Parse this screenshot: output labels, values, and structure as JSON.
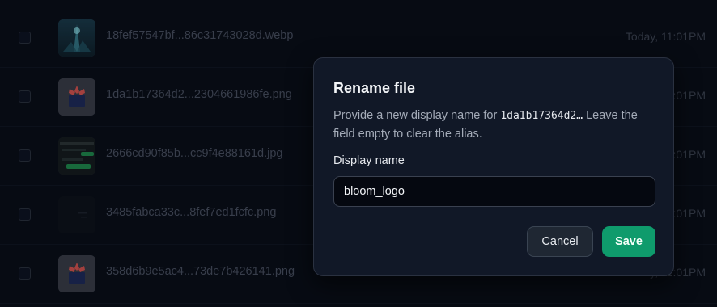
{
  "files": [
    {
      "name": "18fef57547bf...86c31743028d.webp",
      "date": "Today, 11:01PM",
      "thumb": "image-icon"
    },
    {
      "name": "1da1b17364d2...2304661986fe.png",
      "date": "Today, 11:01PM",
      "thumb": "logo-icon"
    },
    {
      "name": "2666cd90f85b...cc9f4e88161d.jpg",
      "date": "Today, 11:01PM",
      "thumb": "screenshot-icon"
    },
    {
      "name": "3485fabca33c...8fef7ed1fcfc.png",
      "date": "Today, 11:01PM",
      "thumb": "dark-image-icon"
    },
    {
      "name": "358d6b9e5ac4...73de7b426141.png",
      "date": "Today, 11:01PM",
      "thumb": "logo-icon"
    }
  ],
  "dialog": {
    "title": "Rename file",
    "desc_prefix": "Provide a new display name for ",
    "desc_filename": "1da1b17364d2…",
    "desc_suffix": " Leave the field empty to clear the alias.",
    "field_label": "Display name",
    "field_value": "bloom_logo",
    "cancel_label": "Cancel",
    "save_label": "Save"
  },
  "colors": {
    "background": "#080c16",
    "dialog_bg": "#111827",
    "save_accent": "#0f9b6c",
    "logo_red": "#d9534f",
    "logo_navy": "#1e2a5a"
  }
}
